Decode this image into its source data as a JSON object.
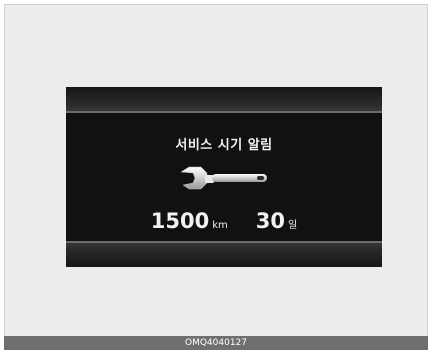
{
  "display": {
    "title": "서비스 시기 알림",
    "icon": "wrench-icon",
    "distance": {
      "value": "1500",
      "unit": "km"
    },
    "days": {
      "value": "30",
      "unit": "일"
    }
  },
  "caption": "OMQ4040127"
}
